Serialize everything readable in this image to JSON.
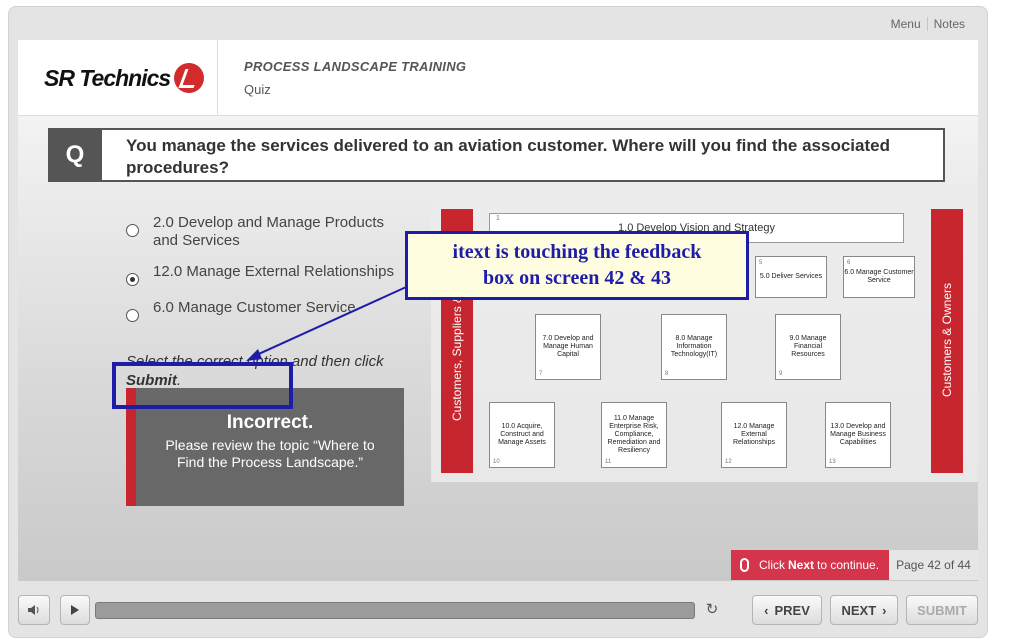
{
  "nav": {
    "menu": "Menu",
    "notes": "Notes"
  },
  "header": {
    "logo": "SR Technics",
    "course_title": "PROCESS LANDSCAPE TRAINING",
    "course_subtitle": "Quiz"
  },
  "question": {
    "badge": "Q",
    "text": "You manage the services delivered to an aviation customer. Where will you find the associated procedures?"
  },
  "options": [
    {
      "label": "2.0 Develop and Manage Products and Services",
      "selected": false
    },
    {
      "label": "12.0 Manage External Relationships",
      "selected": true
    },
    {
      "label": "6.0 Manage Customer Service",
      "selected": false
    }
  ],
  "instruction": {
    "prefix": "Select the correct option and then click ",
    "bold": "Submit",
    "suffix": "."
  },
  "feedback": {
    "title": "Incorrect.",
    "body": "Please review the topic “Where to Find the Process Landscape.”"
  },
  "diagram": {
    "left_bar": "Customers, Suppliers & P",
    "right_bar": "Customers & Owners",
    "top_banner": "1.0 Develop Vision and Strategy",
    "top_banner_num": "1",
    "chevrons": [
      {
        "label": "5.0 Deliver Services",
        "num": "5"
      },
      {
        "label": "6.0 Manage Customer Service",
        "num": "6"
      }
    ],
    "row2": [
      {
        "label": "7.0 Develop and Manage Human Capital",
        "num": "7"
      },
      {
        "label": "8.0 Manage Information Technology(IT)",
        "num": "8"
      },
      {
        "label": "9.0 Manage Financial Resources",
        "num": "9"
      }
    ],
    "row3": [
      {
        "label": "10.0 Acquire, Construct and Manage Assets",
        "num": "10"
      },
      {
        "label": "11.0 Manage Enterprise Risk, Compliance, Remediation and Resiliency",
        "num": "11"
      },
      {
        "label": "12.0 Manage External Relationships",
        "num": "12"
      },
      {
        "label": "13.0 Develop and Manage Business Capabilities",
        "num": "13"
      }
    ]
  },
  "annotation": {
    "text_line1": "itext is touching the feedback",
    "text_line2": "box on screen 42 & 43"
  },
  "footer": {
    "hint_prefix": "Click ",
    "hint_bold": "Next",
    "hint_suffix": " to continue.",
    "page": "Page 42 of 44",
    "prev": "PREV",
    "next": "NEXT",
    "submit": "SUBMIT"
  },
  "colors": {
    "brand_red": "#c7262e",
    "annotation_blue": "#1d1da8"
  }
}
